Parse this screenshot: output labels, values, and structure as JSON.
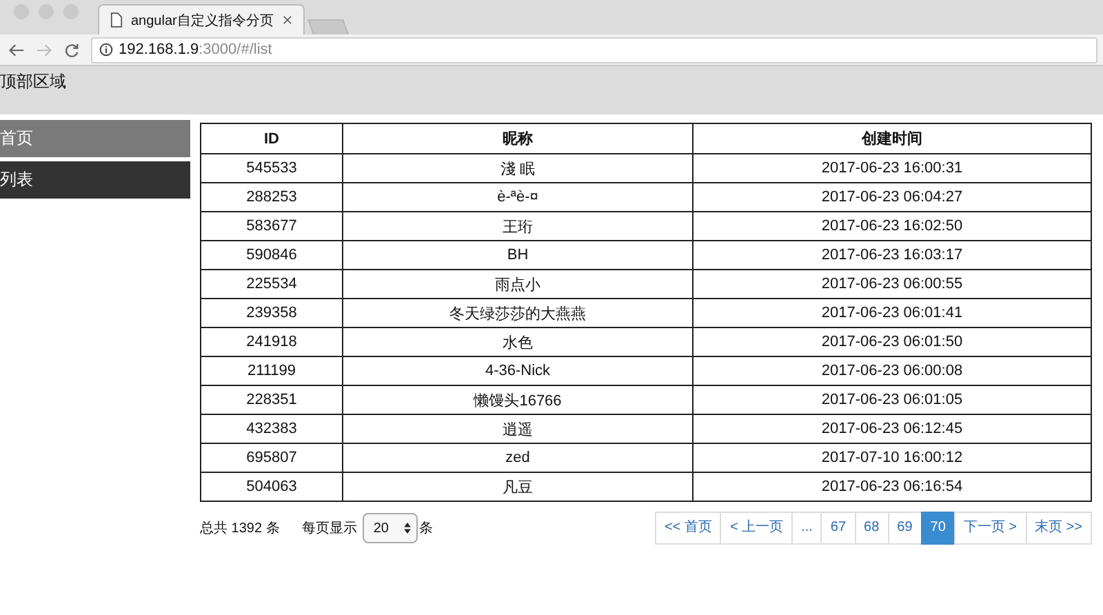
{
  "browser": {
    "tab_title": "angular自定义指令分页",
    "url_host": "192.168.1.9",
    "url_rest": ":3000/#/list"
  },
  "header": {
    "title": "顶部区域"
  },
  "sidebar": {
    "items": [
      {
        "label": "首页",
        "selected": false
      },
      {
        "label": "列表",
        "selected": true
      }
    ]
  },
  "table": {
    "columns": [
      "ID",
      "昵称",
      "创建时间"
    ],
    "rows": [
      [
        "545533",
        "淺 眠",
        "2017-06-23 16:00:31"
      ],
      [
        "288253",
        "è-ªè-¤",
        "2017-06-23 06:04:27"
      ],
      [
        "583677",
        "王珩",
        "2017-06-23 16:02:50"
      ],
      [
        "590846",
        "BH",
        "2017-06-23 16:03:17"
      ],
      [
        "225534",
        "雨点小",
        "2017-06-23 06:00:55"
      ],
      [
        "239358",
        "冬天绿莎莎的大燕燕",
        "2017-06-23 06:01:41"
      ],
      [
        "241918",
        "水色",
        "2017-06-23 06:01:50"
      ],
      [
        "211199",
        "4-36-Nick",
        "2017-06-23 06:00:08"
      ],
      [
        "228351",
        "懒馒头16766",
        "2017-06-23 06:01:05"
      ],
      [
        "432383",
        "逍遥",
        "2017-06-23 06:12:45"
      ],
      [
        "695807",
        "zed",
        "2017-07-10 16:00:12"
      ],
      [
        "504063",
        "凡豆",
        "2017-06-23 06:16:54"
      ]
    ]
  },
  "footer": {
    "total": "总共 1392 条",
    "per_page_label": "每页显示",
    "per_page_value": "20",
    "per_page_unit": "条"
  },
  "pagination": [
    {
      "label": "<< 首页",
      "selected": false
    },
    {
      "label": "< 上一页",
      "selected": false
    },
    {
      "label": "...",
      "selected": false
    },
    {
      "label": "67",
      "selected": false
    },
    {
      "label": "68",
      "selected": false
    },
    {
      "label": "69",
      "selected": false
    },
    {
      "label": "70",
      "selected": true
    },
    {
      "label": "下一页 >",
      "selected": false
    },
    {
      "label": "末页 >>",
      "selected": false
    }
  ]
}
